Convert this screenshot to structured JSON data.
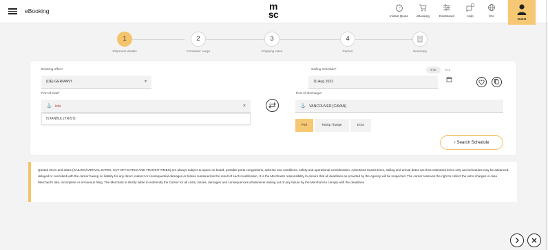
{
  "header": {
    "app_title": "eBooking",
    "logo_text_top": "m",
    "logo_text_bottom": "sc",
    "nav": [
      {
        "label": "Instant Quote",
        "icon": "instant-quote-icon"
      },
      {
        "label": "eBooking",
        "icon": "cart-icon"
      },
      {
        "label": "Dashboard",
        "icon": "sliders-icon"
      },
      {
        "label": "Help",
        "icon": "chat-help-icon"
      },
      {
        "label": "EN",
        "icon": "globe-icon"
      }
    ],
    "guest_label": "Guest"
  },
  "stepper": {
    "steps": [
      {
        "number": "1",
        "label": "Shipment details",
        "active": true
      },
      {
        "number": "2",
        "label": "Container cargo",
        "active": false
      },
      {
        "number": "3",
        "label": "Shipping rates",
        "active": false
      },
      {
        "number": "4",
        "label": "Parties",
        "active": false
      },
      {
        "number": "",
        "label": "Summary",
        "active": false
      }
    ]
  },
  "form": {
    "booking_office_label": "Booking office*",
    "booking_office_value": "(DE) GERMANY",
    "port_of_load_label": "Port of load*",
    "port_of_load_value": "ista",
    "port_of_load_suggestion": "ISTANBUL [TRIST]",
    "sailing_schedule_label": "Sailing schedule*",
    "sailing_schedule_value": "10 Aug 2022",
    "etd_label": "ETD",
    "eta_label": "ETA",
    "port_of_discharge_label": "Port of discharge*",
    "port_of_discharge_value": "VANCOUVER [CAVAN]",
    "modes": [
      "Port",
      "Ramp / barge",
      "Door"
    ],
    "selected_mode": "Port",
    "search_button": "Search Schedule"
  },
  "disclaimer": {
    "text": "Quoted times and dates (SAILING/ARRIVAL DATES, CUT OFF DATES AND TRANSIT TIMES) are always subject to space on board, possible ports congestions, adverse sea conditions, safety and operational consideration. Advertised transit times, sailing and arrival dates are thus estimated times only and schedules may be advanced, delayed or cancelled with the carrier having no liability for any direct, indirect or consequential damages or losses sustained as the result of such modification. It is the Merchants responsibility to ensure that all deadlines as provided by the Agency will be respected. The carrier reserves the right to collect the extra charges in case Merchant's late, incomplete or erroneous filing. The Merchant is strictly liable to indemnify the Carrier for all costs, losses, damages and consequences whatsoever arising out of any failure by the Merchant to comply with the deadlines."
  },
  "colors": {
    "accent": "#f4c46c",
    "background": "#f3f3f3"
  }
}
